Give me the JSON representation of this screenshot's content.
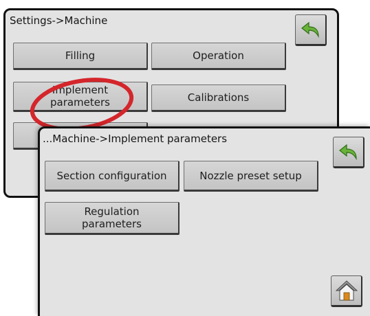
{
  "settings_panel": {
    "title": "Settings->Machine",
    "buttons": {
      "filling": "Filling",
      "operation": "Operation",
      "implement_parameters": "Implement\nparameters",
      "calibrations": "Calibrations"
    }
  },
  "implement_panel": {
    "title": "...Machine->Implement parameters",
    "buttons": {
      "section_configuration": "Section configuration",
      "nozzle_preset_setup": "Nozzle preset setup",
      "regulation_parameters": "Regulation\nparameters"
    }
  },
  "icons": {
    "back": "back-arrow-icon",
    "home": "home-icon"
  },
  "colors": {
    "highlight": "#d4262b",
    "back_arrow": "#6ab23a",
    "home_roof": "#9a9a9a",
    "home_door": "#d98a1e"
  }
}
